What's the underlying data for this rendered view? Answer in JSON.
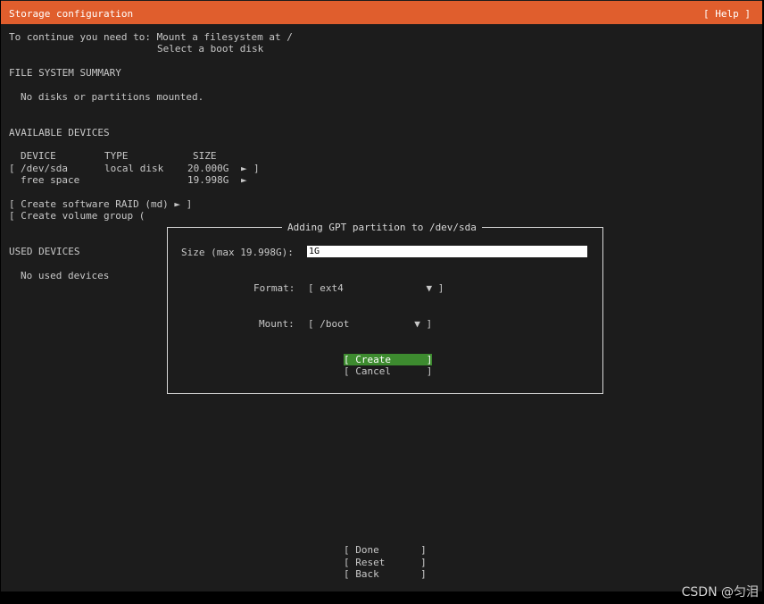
{
  "header": {
    "title": "Storage configuration",
    "help": "[ Help ]"
  },
  "intro": {
    "line1": "To continue you need to: Mount a filesystem at /",
    "line2": "Select a boot disk"
  },
  "fs_summary": {
    "heading": "FILE SYSTEM SUMMARY",
    "empty": "No disks or partitions mounted."
  },
  "available": {
    "heading": "AVAILABLE DEVICES",
    "columns": {
      "device": "DEVICE",
      "type": "TYPE",
      "size": "SIZE"
    },
    "rows": [
      {
        "bracket_open": "[",
        "device": "/dev/sda",
        "type": "local disk",
        "size": "20.000G",
        "arrow": "►",
        "bracket_close": "]"
      },
      {
        "bracket_open": "",
        "device": "free space",
        "type": "",
        "size": "19.998G",
        "arrow": "►",
        "bracket_close": ""
      }
    ],
    "create_raid": "[ Create software RAID (md) ► ]",
    "create_vg": "[ Create volume group ("
  },
  "used": {
    "heading": "USED DEVICES",
    "empty": "No used devices"
  },
  "dialog": {
    "title": "Adding GPT partition to /dev/sda",
    "size_label": "Size (max 19.998G):",
    "size_value": "1G",
    "format_label": "Format:",
    "format_value": "[ ext4              ▼ ]",
    "mount_label": "Mount:",
    "mount_value": "[ /boot           ▼ ]",
    "create": "[ Create      ]",
    "cancel": "[ Cancel      ]"
  },
  "footer": {
    "done": "[ Done       ]",
    "reset": "[ Reset      ]",
    "back": "[ Back       ]"
  },
  "watermark": "CSDN @匀泪",
  "colors": {
    "header": "#e05e2d",
    "background": "#1c1c1c",
    "focus": "#3d8b2f"
  }
}
